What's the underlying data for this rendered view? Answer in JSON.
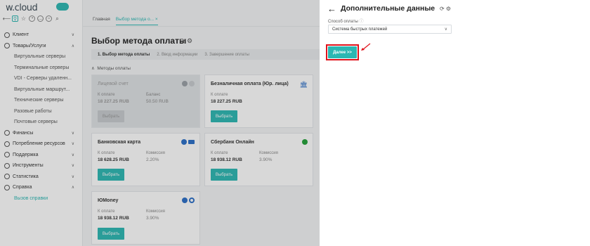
{
  "brand": {
    "name": "w.cloud"
  },
  "sidebar": {
    "items": [
      {
        "label": "Клиент"
      },
      {
        "label": "Товары/Услуги"
      },
      {
        "label": "Финансы"
      },
      {
        "label": "Потребление ресурсов"
      },
      {
        "label": "Поддержка"
      },
      {
        "label": "Инструменты"
      },
      {
        "label": "Статистика"
      },
      {
        "label": "Справка"
      }
    ],
    "sub_products": [
      "Виртуальные серверы",
      "Терминальные серверы",
      "VDI - Серверы удаленн...",
      "Виртуальные маршрут...",
      "Технические серверы",
      "Разовые работы",
      "Почтовые серверы"
    ],
    "sub_help": [
      "Вызов справки"
    ]
  },
  "tabs": [
    "Главная",
    "Выбор метода о..."
  ],
  "page": {
    "title": "Выбор метода оплаты",
    "section": "Методы оплаты"
  },
  "steps": [
    "1. Выбор метода оплаты",
    "2. Ввод информации",
    "3. Завершение оплаты"
  ],
  "cards": [
    {
      "title": "Лицевой счет",
      "l1": "К оплате",
      "v1": "18 227.25 RUB",
      "l2": "Баланс",
      "v2": "50.50 RUB",
      "btn": "Выбрать"
    },
    {
      "title": "Безналичная оплата (Юр. лица)",
      "l1": "К оплате",
      "v1": "18 227.25 RUB",
      "btn": "Выбрать"
    },
    {
      "title": "Банковская карта",
      "l1": "К оплате",
      "v1": "18 628.25 RUB",
      "l2": "Комиссия",
      "v2": "2.20%",
      "btn": "Выбрать"
    },
    {
      "title": "Сбербанк Онлайн",
      "l1": "К оплате",
      "v1": "18 938.12 RUB",
      "l2": "Комиссия",
      "v2": "3.90%",
      "btn": "Выбрать"
    },
    {
      "title": "ЮMoney",
      "l1": "К оплате",
      "v1": "18 938.12 RUB",
      "l2": "Комиссия",
      "v2": "3.90%",
      "btn": "Выбрать"
    }
  ],
  "panel": {
    "title": "Дополнительные данные",
    "field_label": "Способ оплаты",
    "field_value": "Система быстрых платежей",
    "next_btn": "Далее >>"
  },
  "colors": {
    "accent": "#2bb7b3",
    "highlight": "#e0121b"
  }
}
